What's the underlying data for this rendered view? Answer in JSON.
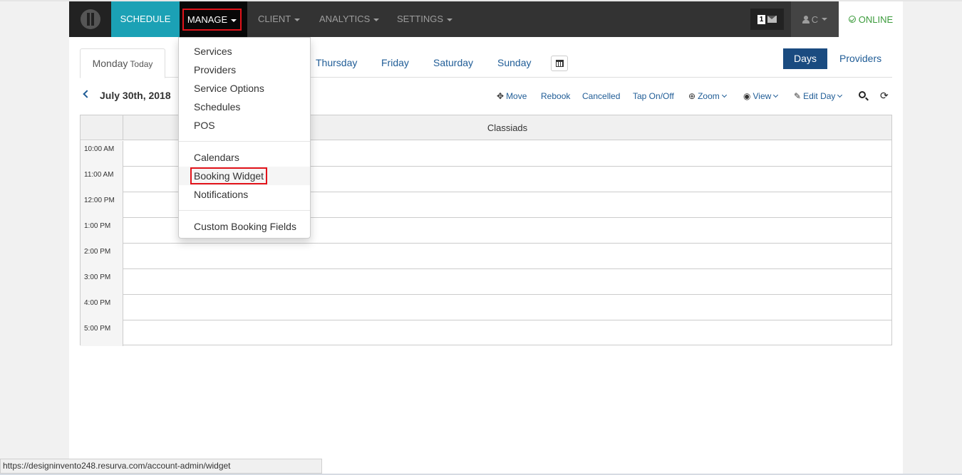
{
  "nav": {
    "schedule": "SCHEDULE",
    "manage": "MANAGE",
    "client": "CLIENT",
    "analytics": "ANALYTICS",
    "settings": "SETTINGS",
    "message_count": "1",
    "user": "C",
    "online": "ONLINE"
  },
  "manage_menu": {
    "group1": [
      "Services",
      "Providers",
      "Service Options",
      "Schedules",
      "POS"
    ],
    "group2": [
      "Calendars",
      "Booking Widget",
      "Notifications"
    ],
    "group3": [
      "Custom Booking Fields"
    ],
    "highlighted": "Booking Widget"
  },
  "tabs": {
    "active_day": "Monday",
    "active_sub": "Today",
    "thursday": "Thursday",
    "friday": "Friday",
    "saturday": "Saturday",
    "sunday": "Sunday"
  },
  "view_toggle": {
    "days": "Days",
    "providers": "Providers"
  },
  "date_header": {
    "date": "July 30th, 2018"
  },
  "toolbar": {
    "move": "Move",
    "rebook": "Rebook",
    "cancelled": "Cancelled",
    "tap": "Tap On/Off",
    "zoom": "Zoom",
    "view": "View",
    "edit_day": "Edit Day"
  },
  "grid": {
    "provider": "Classiads",
    "times": [
      "10:00 AM",
      "11:00 AM",
      "12:00 PM",
      "1:00 PM",
      "2:00 PM",
      "3:00 PM",
      "4:00 PM",
      "5:00 PM"
    ]
  },
  "status_bar": {
    "url": "https://designinvento248.resurva.com/account-admin/widget"
  },
  "colors": {
    "navbar_bg": "#333333",
    "schedule_active": "#1ba1b5",
    "highlight_border": "#e2131a",
    "days_button": "#1a4b80",
    "link": "#1f5c96",
    "online": "#3c9b3c"
  }
}
